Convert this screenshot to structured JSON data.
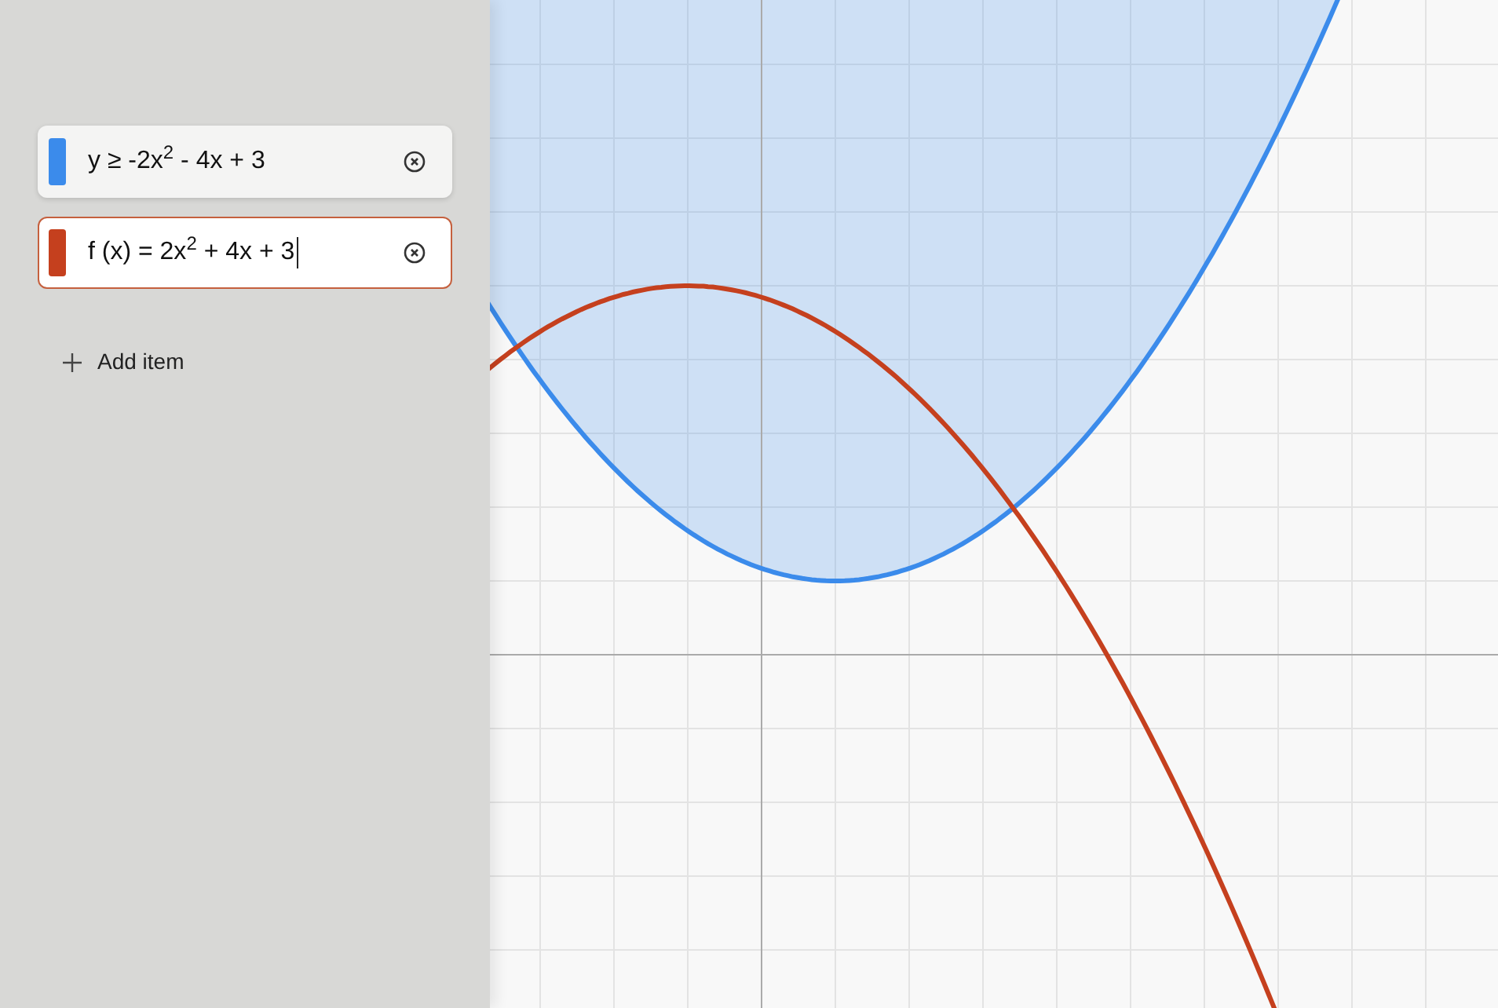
{
  "sidebar": {
    "expressions": [
      {
        "text": "y ≥ -2x$^{2}$ - 4x + 3",
        "color": "#3b8beb",
        "selected": false
      },
      {
        "text": "f (x) = 2x$^{2}$ + 4x + 3",
        "color": "#c5401e",
        "selected": true
      }
    ],
    "add_button": "Add item"
  }
}
